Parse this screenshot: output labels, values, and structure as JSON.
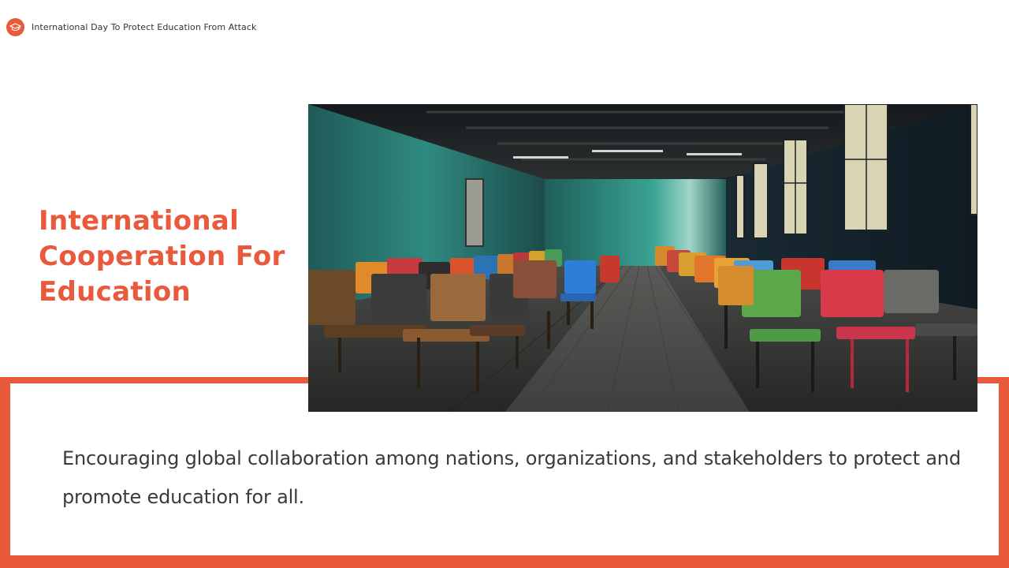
{
  "header": {
    "text": "International  Day To Protect Education From Attack",
    "icon": "graduation-cap-icon"
  },
  "title": {
    "line1": "International",
    "line2": "Cooperation For",
    "line3": "Education"
  },
  "body": {
    "text": "Encouraging global collaboration among nations, organizations, and stakeholders to protect and promote education for all."
  },
  "photo": {
    "subject": "empty classroom with rows of colorful chairs"
  },
  "colors": {
    "accent": "#E9593B",
    "text_dark": "#3a3a3a",
    "background": "#ffffff"
  }
}
